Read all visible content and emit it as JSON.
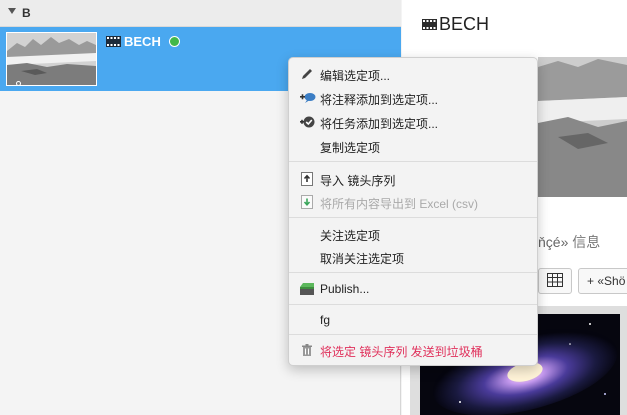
{
  "group": {
    "label": "B"
  },
  "selected_item": {
    "title": "BECH"
  },
  "detail": {
    "title": "BECH",
    "info_heading_prefix": "ňçé»",
    "info_heading_suffix": " 信息",
    "add_button_label": "+ «Shö"
  },
  "context_menu": {
    "items": [
      {
        "label": "编辑选定项...",
        "icon": "pencil-icon"
      },
      {
        "label": "将注释添加到选定项...",
        "icon": "add-note-icon"
      },
      {
        "label": "将任务添加到选定项...",
        "icon": "add-task-icon"
      },
      {
        "label": "复制选定项",
        "icon": ""
      },
      {
        "label": "导入 镜头序列",
        "icon": "import-icon"
      },
      {
        "label": "将所有内容导出到 Excel (csv)",
        "icon": "export-icon"
      },
      {
        "label": "关注选定项",
        "icon": ""
      },
      {
        "label": "取消关注选定项",
        "icon": ""
      },
      {
        "label": "Publish...",
        "icon": "publish-icon"
      },
      {
        "label": "fg",
        "icon": ""
      },
      {
        "label": "将选定 镜头序列 发送到垃圾桶",
        "icon": "trash-icon"
      }
    ]
  },
  "colors": {
    "selection": "#4aa8f0",
    "status_ok": "#41b84a",
    "danger_text": "#e0305b",
    "disabled_text": "#a9a9a9"
  }
}
